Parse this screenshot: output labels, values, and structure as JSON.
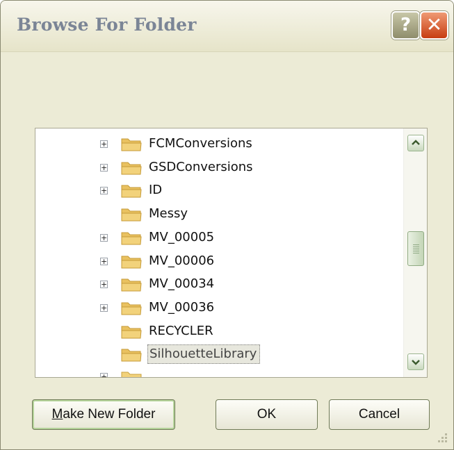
{
  "window": {
    "title": "Browse For Folder",
    "help_glyph": "?",
    "close_glyph": "✕"
  },
  "tree": {
    "items": [
      {
        "label": "FCMConversions",
        "expandable": true
      },
      {
        "label": "GSDConversions",
        "expandable": true
      },
      {
        "label": "ID",
        "expandable": true
      },
      {
        "label": "Messy",
        "expandable": false
      },
      {
        "label": "MV_00005",
        "expandable": true
      },
      {
        "label": "MV_00006",
        "expandable": true
      },
      {
        "label": "MV_00034",
        "expandable": true
      },
      {
        "label": "MV_00036",
        "expandable": true
      },
      {
        "label": "RECYCLER",
        "expandable": false
      },
      {
        "label": "SilhouetteLibrary",
        "expandable": false,
        "selected": true
      }
    ],
    "expander_glyph": "+",
    "folder_color": "#f2d27b",
    "selected_item": "SilhouetteLibrary"
  },
  "buttons": {
    "make_new_folder_mnemonic": "M",
    "make_new_folder_rest": "ake New Folder",
    "ok": "OK",
    "cancel": "Cancel"
  },
  "colors": {
    "dialog_face": "#ecebd6",
    "close_button": "#c73d12",
    "scrollbar_accent": "#c9d9be"
  }
}
